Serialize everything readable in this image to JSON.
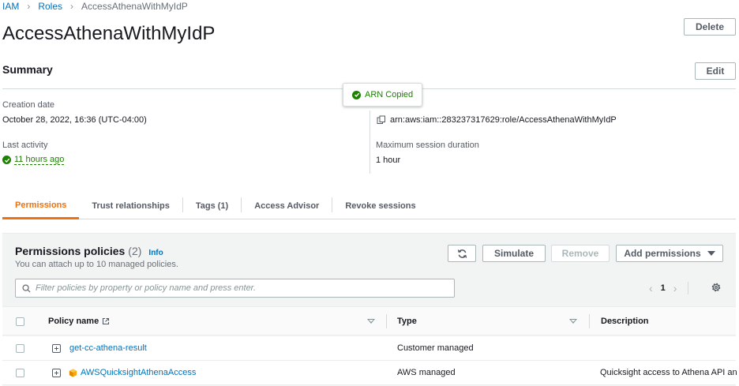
{
  "breadcrumb": {
    "items": [
      "IAM",
      "Roles"
    ],
    "current": "AccessAthenaWithMyIdP"
  },
  "page_title": "AccessAthenaWithMyIdP",
  "buttons": {
    "delete": "Delete",
    "edit": "Edit"
  },
  "summary": {
    "title": "Summary",
    "creation_date_label": "Creation date",
    "creation_date_value": "October 28, 2022, 16:36 (UTC-04:00)",
    "last_activity_label": "Last activity",
    "last_activity_value": "11 hours ago",
    "arn_value": "arn:aws:iam::283237317629:role/AccessAthenaWithMyIdP",
    "max_session_label": "Maximum session duration",
    "max_session_value": "1 hour"
  },
  "toast": {
    "text": "ARN Copied"
  },
  "tabs": [
    "Permissions",
    "Trust relationships",
    "Tags (1)",
    "Access Advisor",
    "Revoke sessions"
  ],
  "permissions": {
    "title": "Permissions policies",
    "count": "(2)",
    "info": "Info",
    "subtitle": "You can attach up to 10 managed policies.",
    "simulate": "Simulate",
    "remove": "Remove",
    "add_permissions": "Add permissions",
    "filter_placeholder": "Filter policies by property or policy name and press enter.",
    "page": "1",
    "columns": {
      "policy_name": "Policy name",
      "type": "Type",
      "description": "Description"
    },
    "rows": [
      {
        "name": "get-cc-athena-result",
        "type": "Customer managed",
        "description": ""
      },
      {
        "name": "AWSQuicksightAthenaAccess",
        "type": "AWS managed",
        "description": "Quicksight access to Athena API an"
      }
    ]
  },
  "colors": {
    "link": "#0073bb",
    "success": "#1d8102",
    "active_tab": "#ec7211"
  }
}
